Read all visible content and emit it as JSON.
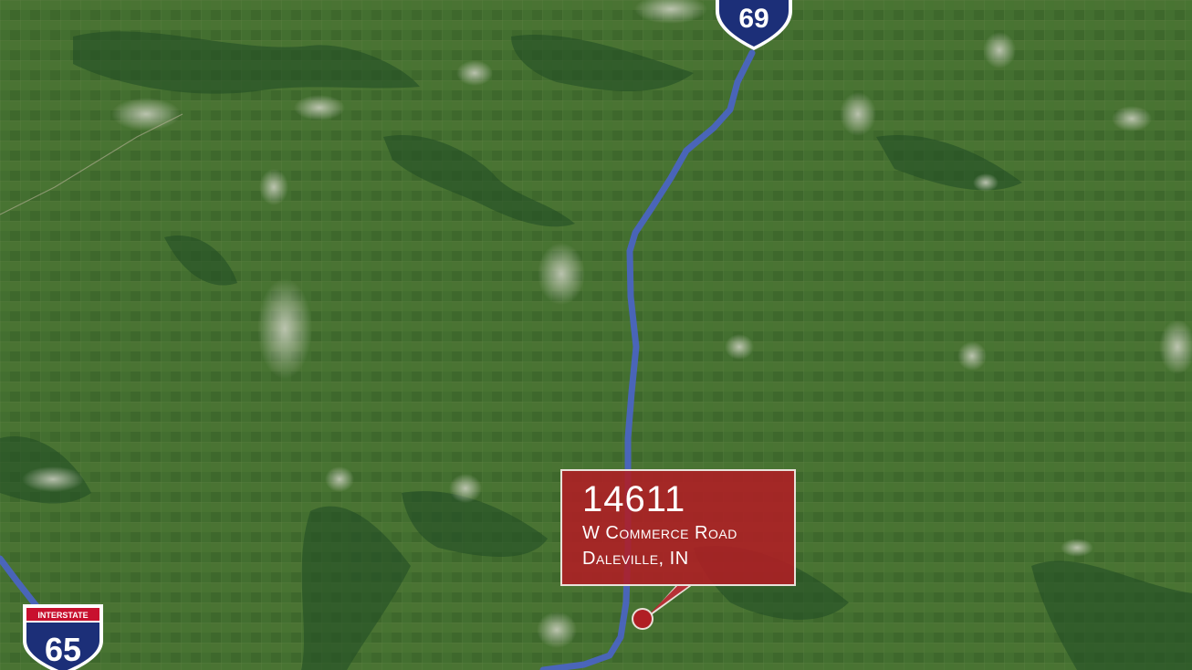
{
  "map": {
    "highways": [
      {
        "name": "I-69",
        "number": "69",
        "color": "#1c2f78"
      },
      {
        "name": "I-65",
        "number": "65",
        "banner": "INTERSTATE",
        "color": "#1c2f78",
        "banner_color": "#c8102e"
      }
    ],
    "route_color": "#4a64c8",
    "marker": {
      "number": "14611",
      "street": "W Commerce Road",
      "city": "Daleville, IN",
      "color": "#b01e24"
    }
  }
}
